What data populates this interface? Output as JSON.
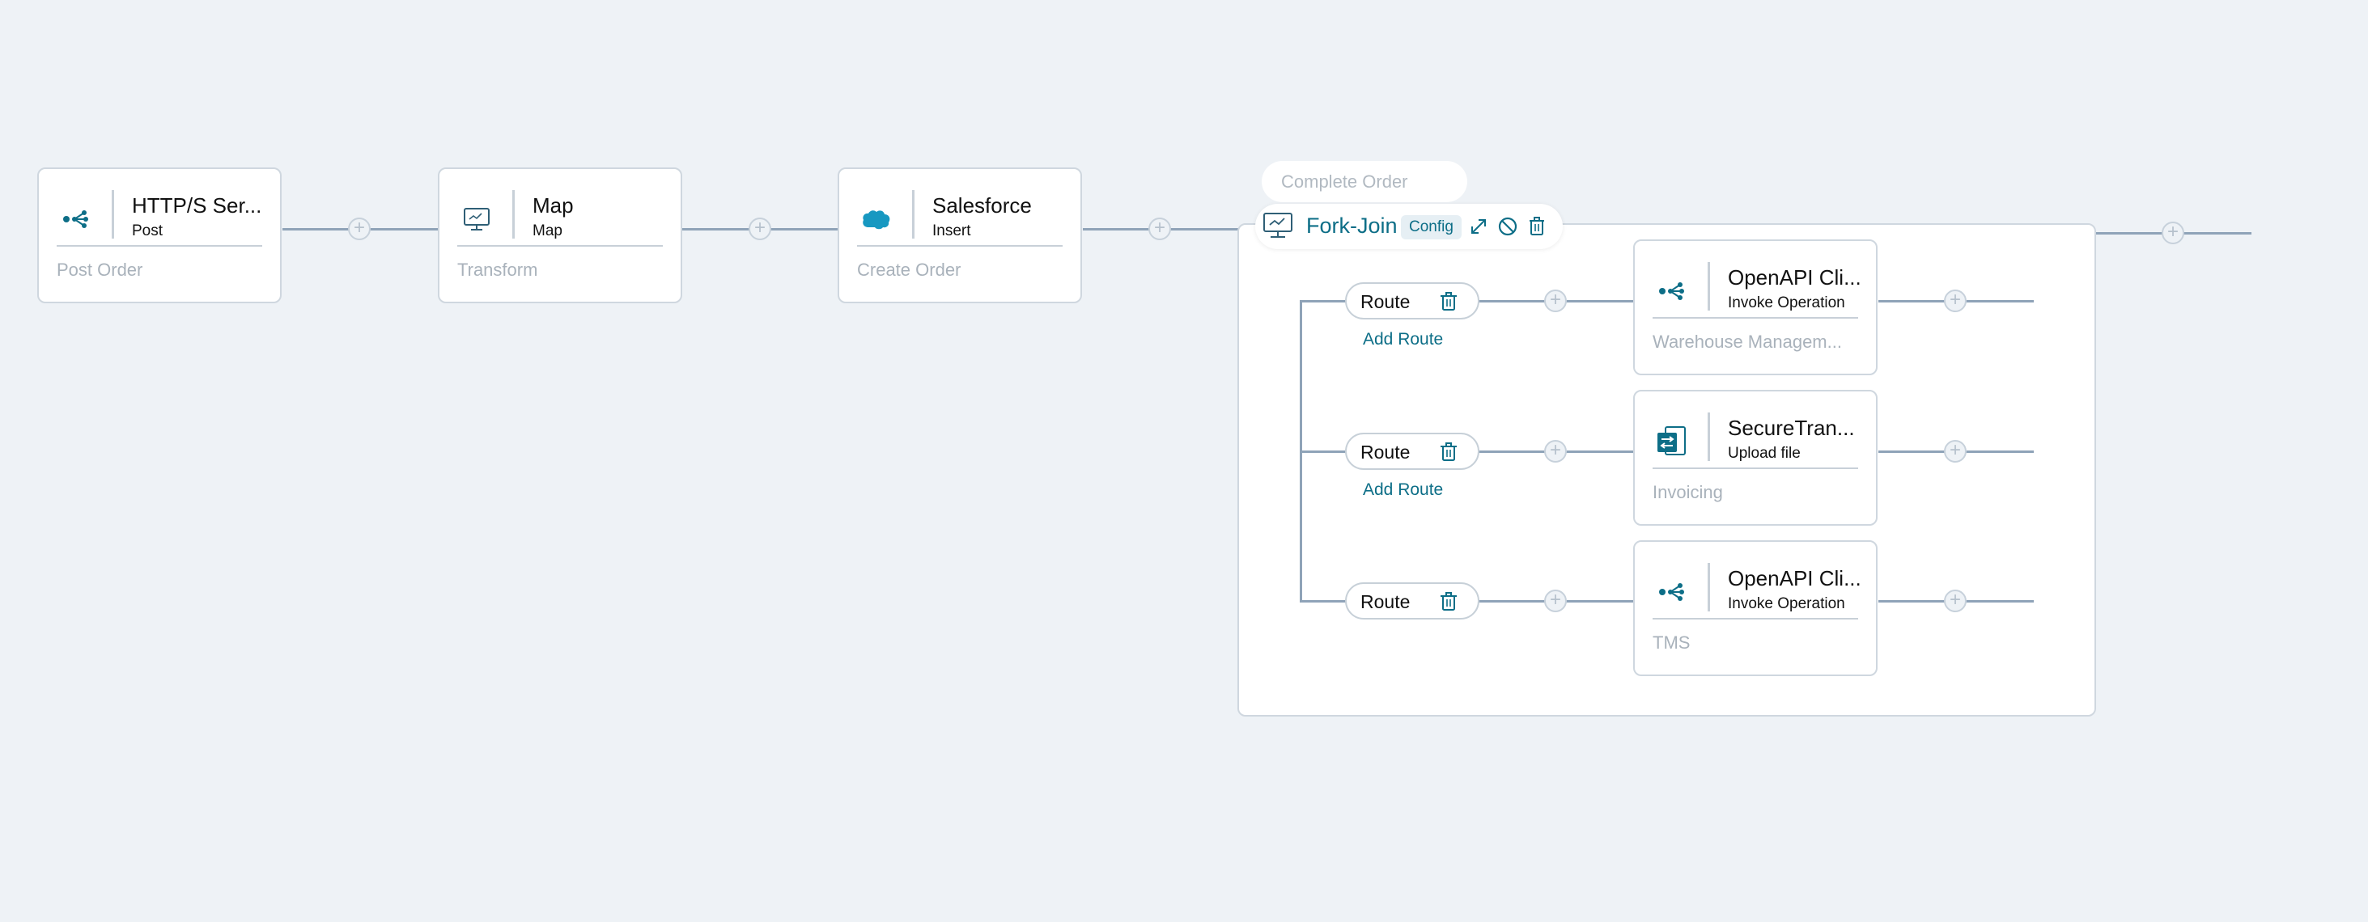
{
  "flow": {
    "steps": [
      {
        "title": "HTTP/S Ser...",
        "subtitle": "Post",
        "description": "Post Order",
        "icon": "endpoint-icon"
      },
      {
        "title": "Map",
        "subtitle": "Map",
        "description": "Transform",
        "icon": "monitor-icon"
      },
      {
        "title": "Salesforce",
        "subtitle": "Insert",
        "description": "Create Order",
        "icon": "salesforce-icon"
      }
    ]
  },
  "fork_join": {
    "name_placeholder": "Complete Order",
    "title": "Fork-Join",
    "config_label": "Config",
    "actions": [
      "expand-icon",
      "disable-icon",
      "trash-icon"
    ],
    "routes": [
      {
        "label": "Route",
        "add_route": "Add Route",
        "step": {
          "title": "OpenAPI Cli...",
          "subtitle": "Invoke Operation",
          "description": "Warehouse Managem...",
          "icon": "endpoint-icon"
        }
      },
      {
        "label": "Route",
        "add_route": "Add Route",
        "step": {
          "title": "SecureTran...",
          "subtitle": "Upload file",
          "description": "Invoicing",
          "icon": "file-transfer-icon"
        }
      },
      {
        "label": "Route",
        "add_route": "",
        "step": {
          "title": "OpenAPI Cli...",
          "subtitle": "Invoke Operation",
          "description": "TMS",
          "icon": "endpoint-icon"
        }
      }
    ]
  },
  "colors": {
    "accent": "#0d6e87",
    "connector": "#8fa3b8",
    "background": "#eef2f6",
    "salesforce": "#1798c1"
  }
}
